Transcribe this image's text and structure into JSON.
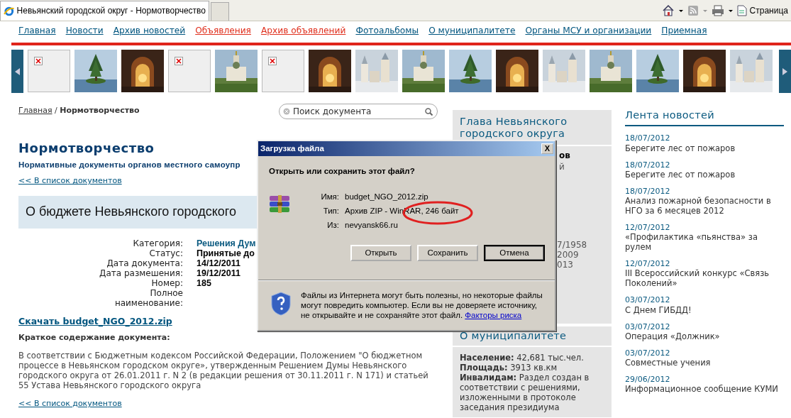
{
  "browser": {
    "tab_title": "Невьянский городской округ - Нормотворчество",
    "page_menu": "Страница"
  },
  "nav": [
    {
      "label": "Главная",
      "color": "#00557f"
    },
    {
      "label": "Новости",
      "color": "#00557f"
    },
    {
      "label": "Архив новостей",
      "color": "#00557f"
    },
    {
      "label": "Объявления",
      "color": "#e0301e"
    },
    {
      "label": "Архив объявлений",
      "color": "#e0301e"
    },
    {
      "label": "Фотоальбомы",
      "color": "#00557f"
    },
    {
      "label": "О муниципалитете",
      "color": "#00557f"
    },
    {
      "label": "Органы МСУ и организации",
      "color": "#00557f"
    },
    {
      "label": "Приемная",
      "color": "#00557f"
    }
  ],
  "gallery": [
    {
      "kind": "broken"
    },
    {
      "kind": "picture"
    },
    {
      "kind": "picture"
    },
    {
      "kind": "broken"
    },
    {
      "kind": "picture"
    },
    {
      "kind": "broken"
    },
    {
      "kind": "picture"
    },
    {
      "kind": "picture"
    },
    {
      "kind": "picture"
    },
    {
      "kind": "picture"
    },
    {
      "kind": "picture"
    },
    {
      "kind": "picture"
    },
    {
      "kind": "picture"
    },
    {
      "kind": "picture"
    },
    {
      "kind": "picture"
    },
    {
      "kind": "picture"
    }
  ],
  "breadcrumb": {
    "home": "Главная",
    "separator": "/",
    "current": "Нормотворчество"
  },
  "search": {
    "placeholder": "Поиск документа"
  },
  "page_title": "Нормотворчество",
  "subtitle": "Нормативные документы органов местного самоупр",
  "back_link": "<< В список документов",
  "doc_title": "О бюджете Невьянского городского",
  "meta": [
    {
      "label": "Категория:",
      "value": "Решения Дум",
      "kind": "link"
    },
    {
      "label": "Статус:",
      "value": "Принятые до",
      "kind": "bold"
    },
    {
      "label": "Дата документа:",
      "value": "14/12/2011",
      "kind": "bold"
    },
    {
      "label": "Дата размешения:",
      "value": "19/12/2011",
      "kind": "bold"
    },
    {
      "label": "Номер:",
      "value": "185",
      "kind": "bold"
    },
    {
      "label": "Полное наименование:",
      "kind": "empty"
    }
  ],
  "download_link": "Скачать budget_NGO_2012.zip",
  "summary_heading": "Краткое содержание документа:",
  "summary_text": "В соответствии с Бюджетным кодексом Российской Федерации, Положением \"О бюджетном процессе в Невьянском городском округе», утвержденным Решением Думы Невьянского городского округа от 26.01.2011 г. N 2 (в редакции решения от 30.11.2011 г. N 171) и статьей 55 Устава Невьянского городского округа",
  "back_link_bottom": "<< В список документов",
  "glava": {
    "title": "Глава Невьянского городского округа",
    "fragments": [
      {
        "text": "ов",
        "bold": true
      },
      {
        "text": "й",
        "bold": false
      },
      {
        "text": "7/1958",
        "bold": false
      },
      {
        "text": "2009",
        "bold": false
      },
      {
        "text": "013",
        "bold": false
      }
    ]
  },
  "municipality": {
    "title": "О муниципалитете",
    "lines": [
      "**Население:** 42,681 тыс.чел.",
      "**Площадь:** 3913 кв.км",
      "**Инвалидам:** Раздел создан в соответствии с решениями, изложенными в протоколе заседания президиума"
    ]
  },
  "news": {
    "title": "Лента новостей",
    "items": [
      {
        "date": "18/07/2012",
        "title": "Берегите лес от пожаров"
      },
      {
        "date": "18/07/2012",
        "title": "Берегите лес от пожаров"
      },
      {
        "date": "18/07/2012",
        "title": "Анализ пожарной безопасности в НГО за 6 месяцев 2012"
      },
      {
        "date": "12/07/2012",
        "title": "«Профилактика «пьянства» за рулем"
      },
      {
        "date": "12/07/2012",
        "title": "III Всероссийский конкурс «Связь Поколений»"
      },
      {
        "date": "03/07/2012",
        "title": "С Днем ГИБДД!"
      },
      {
        "date": "03/07/2012",
        "title": "Операция «Должник»"
      },
      {
        "date": "03/07/2012",
        "title": "Совместные учения"
      },
      {
        "date": "29/06/2012",
        "title": "Информационное сообщение КУМИ"
      }
    ]
  },
  "dialog": {
    "title": "Загрузка файла",
    "close": "X",
    "question": "Открыть или сохранить этот файл?",
    "fields": [
      {
        "label": "Имя:",
        "value": "budget_NGO_2012.zip"
      },
      {
        "label": "Тип:",
        "value": "Архив ZIP - WinRAR, 246 байт"
      },
      {
        "label": "Из:",
        "value": "nevyansk66.ru"
      }
    ],
    "buttons": [
      {
        "label": "Открыть",
        "default": false
      },
      {
        "label": "Сохранить",
        "default": false
      },
      {
        "label": "Отмена",
        "default": true
      }
    ],
    "warning": "Файлы из Интернета могут быть полезны, но некоторые файлы могут повредить компьютер. Если вы не доверяете источнику, не открывайте и не сохраняйте этот файл.",
    "risk_link": "Факторы риска"
  }
}
